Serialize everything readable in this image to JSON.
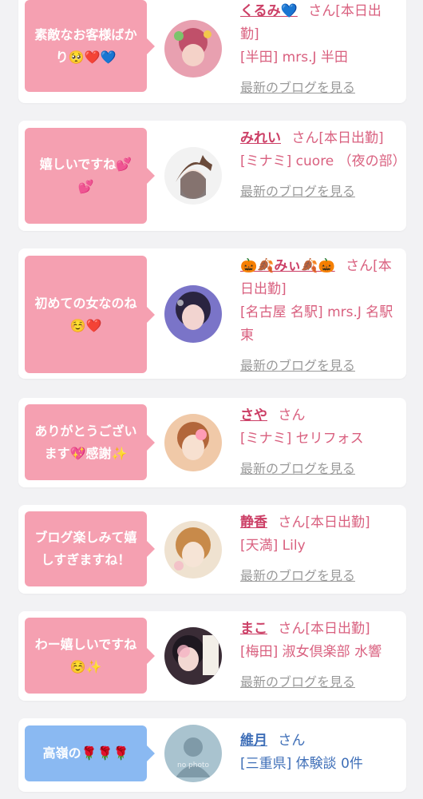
{
  "reviews": [
    {
      "message": "素敵なお客様ばかり🥺❤️💙",
      "name": "くるみ💙",
      "suffix": "さん[本日出勤]",
      "shop": "[半田] mrs.J 半田",
      "blog_link": "最新のブログを見る"
    },
    {
      "message": "嬉しいですね💕💕",
      "name": "みれい",
      "suffix": "さん[本日出勤]",
      "shop": "[ミナミ] cuore （夜の部）",
      "blog_link": "最新のブログを見る"
    },
    {
      "message": "初めての女なのね☺️❤️",
      "name": "🎃🍂みぃ🍂🎃",
      "suffix": "さん[本日出勤]",
      "shop": "[名古屋 名駅] mrs.J 名駅東",
      "blog_link": "最新のブログを見る"
    },
    {
      "message": "ありがとうございます💖感謝✨",
      "name": "さや",
      "suffix": "さん",
      "shop": "[ミナミ] セリフォス",
      "blog_link": "最新のブログを見る"
    },
    {
      "message": "ブログ楽しみて嬉しすぎますね！",
      "name": "静香",
      "suffix": "さん[本日出勤]",
      "shop": "[天満] Lily",
      "blog_link": "最新のブログを見る"
    },
    {
      "message": "わー嬉しいですね☺️✨",
      "name": "まこ",
      "suffix": "さん[本日出勤]",
      "shop": "[梅田] 淑女倶楽部 水響",
      "blog_link": "最新のブログを見る"
    },
    {
      "message": "高嶺の🌹🌹🌹",
      "name": "維月",
      "suffix": "さん",
      "shop": "[三重県] 体験談 0件",
      "avatar_text": "no photo"
    }
  ],
  "colors": {
    "bubble_pink": "#f5a0b1",
    "bubble_blue": "#8ab9f2",
    "name_pink": "#cc3f66",
    "name_blue": "#3f6fb8",
    "link_gray": "#9a9a9a"
  }
}
